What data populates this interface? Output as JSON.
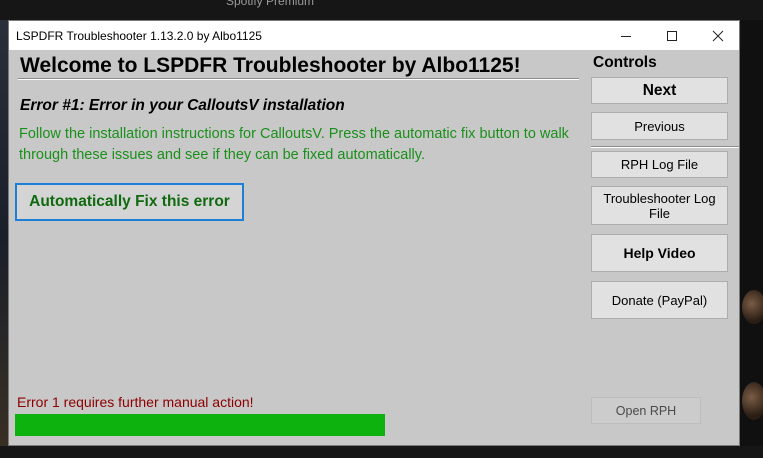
{
  "background": {
    "top_text": "Spotify Premium"
  },
  "window": {
    "title": "LSPDFR Troubleshooter 1.13.2.0 by Albo1125",
    "controls_icons": [
      "minimize-icon",
      "maximize-icon",
      "close-icon"
    ]
  },
  "main": {
    "welcome": "Welcome to LSPDFR Troubleshooter by Albo1125!",
    "error_title": "Error #1: Error in your CalloutsV installation",
    "error_description": "Follow the installation instructions for CalloutsV. Press the automatic fix button to walk through these issues and see if they can be fixed automatically.",
    "fix_button": "Automatically Fix this error",
    "manual_message": "Error 1 requires further manual action!",
    "progress": 1.0
  },
  "sidebar": {
    "label": "Controls",
    "next": "Next",
    "previous": "Previous",
    "rph_log": "RPH Log File",
    "troubleshooter_log": "Troubleshooter Log File",
    "help_video": "Help Video",
    "donate": "Donate (PayPal)",
    "open_rph": "Open RPH"
  },
  "colors": {
    "window_bg": "#c8c8c8",
    "success_text": "#1a8f1a",
    "error_text": "#8b0000",
    "progress_fill": "#0eb20e",
    "focus_border": "#1e7fd6"
  }
}
